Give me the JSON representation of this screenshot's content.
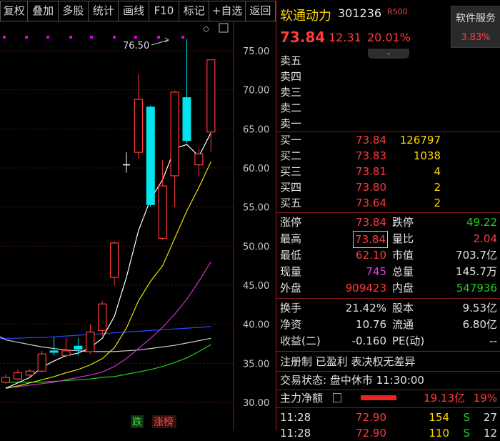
{
  "toolbar": {
    "buttons": [
      "复权",
      "叠加",
      "多股",
      "统计",
      "画线",
      "F10",
      "标记",
      "+自选",
      "返回"
    ]
  },
  "chart": {
    "price_axis": [
      "75.00",
      "70.00",
      "65.00",
      "60.00",
      "55.00",
      "50.00",
      "45.00",
      "40.00",
      "35.00",
      "30.00"
    ],
    "high_label": "76.50",
    "tag_down": "跌",
    "tag_rank": "涨榜"
  },
  "stock": {
    "name": "软通动力",
    "code": "301236",
    "badge": "R500",
    "price": "73.84",
    "change": "12.31",
    "change_pct": "20.01%",
    "service_label": "软件服务",
    "service_pct": "3.83%"
  },
  "order_book": {
    "asks": [
      {
        "label": "卖五",
        "price": "",
        "vol": ""
      },
      {
        "label": "卖四",
        "price": "",
        "vol": ""
      },
      {
        "label": "卖三",
        "price": "",
        "vol": ""
      },
      {
        "label": "卖二",
        "price": "",
        "vol": ""
      },
      {
        "label": "卖一",
        "price": "",
        "vol": ""
      }
    ],
    "bids": [
      {
        "label": "买一",
        "price": "73.84",
        "vol": "126797"
      },
      {
        "label": "买二",
        "price": "73.83",
        "vol": "1038"
      },
      {
        "label": "买三",
        "price": "73.81",
        "vol": "4"
      },
      {
        "label": "买四",
        "price": "73.80",
        "vol": "2"
      },
      {
        "label": "买五",
        "price": "73.64",
        "vol": "2"
      }
    ]
  },
  "stats": [
    {
      "l1": "涨停",
      "v1": "73.84",
      "l2": "跌停",
      "v2": "49.22"
    },
    {
      "l1": "最高",
      "v1": "73.84",
      "l2": "量比",
      "v2": "2.04"
    },
    {
      "l1": "最低",
      "v1": "62.10",
      "l2": "市值",
      "v2": "703.7亿"
    },
    {
      "l1": "现量",
      "v1": "745",
      "l2": "总量",
      "v2": "145.7万"
    },
    {
      "l1": "外盘",
      "v1": "909423",
      "l2": "内盘",
      "v2": "547936"
    }
  ],
  "fund": [
    {
      "l1": "换手",
      "v1": "21.42%",
      "l2": "股本",
      "v2": "9.53亿"
    },
    {
      "l1": "净资",
      "v1": "10.76",
      "l2": "流通",
      "v2": "6.80亿"
    },
    {
      "l1": "收益(二)",
      "v1": "-0.160",
      "l2": "PE(动)",
      "v2": "--"
    }
  ],
  "info": {
    "reg": "注册制 已盈利 表决权无差异",
    "status": "交易状态: 盘中休市 11:30:00",
    "main_flow_label": "主力净额",
    "main_flow_value": "19.13亿",
    "main_flow_pct": "19%"
  },
  "ticks": [
    {
      "time": "11:28",
      "price": "72.90",
      "vol": "154",
      "bs": "S",
      "n": "27"
    },
    {
      "time": "11:28",
      "price": "72.90",
      "vol": "110",
      "bs": "S",
      "n": "12"
    }
  ],
  "colors": {
    "up": "#ff3b3b",
    "down": "#00e5ee",
    "gold": "#ffd700",
    "green": "#22cc22",
    "magenta": "#e040e0"
  },
  "chart_data": {
    "type": "candlestick",
    "ylim": [
      29,
      77
    ],
    "candles": [
      {
        "o": 32.6,
        "c": 33.2,
        "h": 33.6,
        "l": 32.4,
        "dir": "up"
      },
      {
        "o": 33.0,
        "c": 33.8,
        "h": 34.2,
        "l": 32.8,
        "dir": "up"
      },
      {
        "o": 33.5,
        "c": 34.0,
        "h": 34.3,
        "l": 33.2,
        "dir": "up"
      },
      {
        "o": 34.0,
        "c": 36.2,
        "h": 36.6,
        "l": 33.8,
        "dir": "up"
      },
      {
        "o": 36.4,
        "c": 36.6,
        "h": 38.4,
        "l": 36.0,
        "dir": "down"
      },
      {
        "o": 36.0,
        "c": 36.6,
        "h": 38.3,
        "l": 35.7,
        "dir": "up"
      },
      {
        "o": 36.8,
        "c": 37.2,
        "h": 38.3,
        "l": 36.0,
        "dir": "down"
      },
      {
        "o": 36.5,
        "c": 39.0,
        "h": 40.0,
        "l": 36.2,
        "dir": "up"
      },
      {
        "o": 39.2,
        "c": 42.6,
        "h": 43.0,
        "l": 38.5,
        "dir": "up"
      },
      {
        "o": 46.0,
        "c": 50.4,
        "h": 50.6,
        "l": 45.0,
        "dir": "up"
      },
      {
        "o": 60.4,
        "c": 60.4,
        "h": 62.0,
        "l": 59.4,
        "dir": "flat"
      },
      {
        "o": 62.0,
        "c": 68.8,
        "h": 72.0,
        "l": 61.2,
        "dir": "up"
      },
      {
        "o": 67.8,
        "c": 55.3,
        "h": 68.0,
        "l": 55.0,
        "dir": "down"
      },
      {
        "o": 51.0,
        "c": 57.7,
        "h": 61.0,
        "l": 50.8,
        "dir": "up"
      },
      {
        "o": 59.0,
        "c": 69.7,
        "h": 69.9,
        "l": 55.0,
        "dir": "up"
      },
      {
        "o": 69.0,
        "c": 63.5,
        "h": 76.5,
        "l": 63.2,
        "dir": "down"
      },
      {
        "o": 60.4,
        "c": 61.8,
        "h": 62.5,
        "l": 58.9,
        "dir": "up"
      },
      {
        "o": 64.6,
        "c": 73.84,
        "h": 73.84,
        "l": 62.1,
        "dir": "up"
      }
    ],
    "ma_white": [
      31.8,
      32.5,
      33.2,
      34.5,
      35.3,
      36.0,
      36.3,
      37.0,
      38.2,
      41.0,
      46.0,
      52.0,
      56.0,
      58.5,
      62.5,
      63.0,
      61.5,
      64.5
    ],
    "ma_yellow": [
      31.8,
      32.1,
      32.5,
      32.9,
      33.3,
      33.8,
      34.2,
      34.8,
      35.6,
      37.0,
      39.5,
      43.0,
      45.5,
      47.5,
      51.0,
      54.5,
      57.5,
      60.8
    ],
    "ma_magenta": [
      31.9,
      32.0,
      32.2,
      32.4,
      32.6,
      32.9,
      33.2,
      33.5,
      33.9,
      34.6,
      35.6,
      36.9,
      38.2,
      39.6,
      41.3,
      43.2,
      45.5,
      48.0
    ],
    "ma_green": [
      32.6,
      32.6,
      32.6,
      32.6,
      32.7,
      32.8,
      32.9,
      33.0,
      33.2,
      33.3,
      33.6,
      33.9,
      34.2,
      34.6,
      35.1,
      35.7,
      36.5,
      37.4
    ],
    "ma_blue": [
      38.2,
      38.2,
      38.3,
      38.3,
      38.4,
      38.5,
      38.6,
      38.7,
      38.8,
      38.9,
      39.0,
      39.1,
      39.2,
      39.3,
      39.4,
      39.5,
      39.6,
      39.7
    ],
    "ma_gray": [
      38.0,
      37.7,
      37.4,
      37.1,
      36.9,
      36.7,
      36.6,
      36.5,
      36.5,
      36.5,
      36.6,
      36.7,
      36.9,
      37.1,
      37.3,
      37.6,
      37.9,
      38.2
    ]
  }
}
